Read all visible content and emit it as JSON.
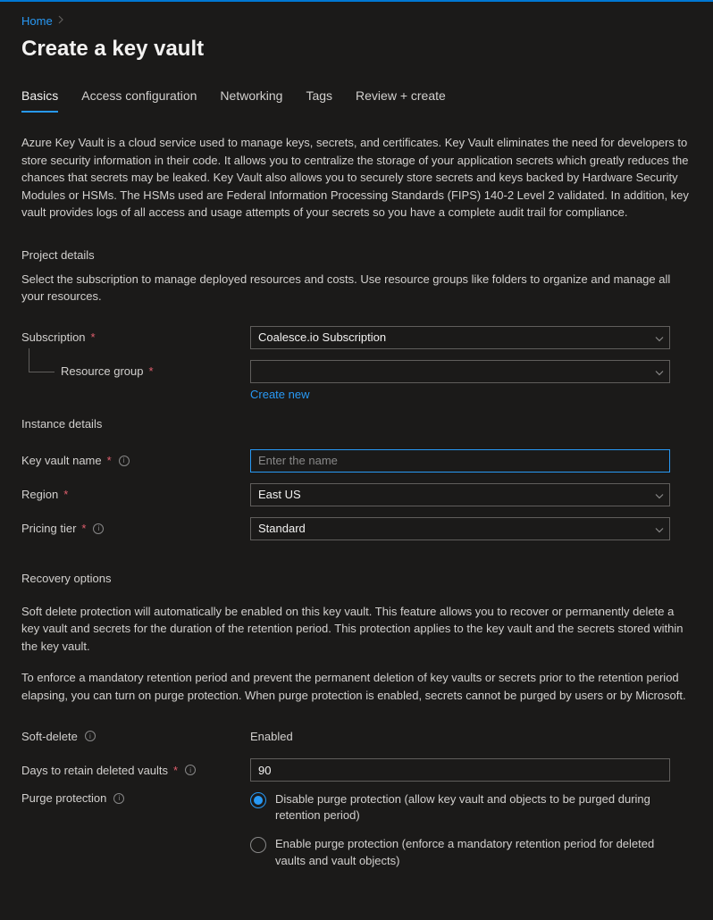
{
  "breadcrumb": {
    "home": "Home"
  },
  "page_title": "Create a key vault",
  "tabs": {
    "basics": "Basics",
    "access": "Access configuration",
    "networking": "Networking",
    "tags": "Tags",
    "review": "Review + create"
  },
  "description": "Azure Key Vault is a cloud service used to manage keys, secrets, and certificates. Key Vault eliminates the need for developers to store security information in their code. It allows you to centralize the storage of your application secrets which greatly reduces the chances that secrets may be leaked. Key Vault also allows you to securely store secrets and keys backed by Hardware Security Modules or HSMs. The HSMs used are Federal Information Processing Standards (FIPS) 140-2 Level 2 validated. In addition, key vault provides logs of all access and usage attempts of your secrets so you have a complete audit trail for compliance.",
  "project_details": {
    "title": "Project details",
    "desc": "Select the subscription to manage deployed resources and costs. Use resource groups like folders to organize and manage all your resources.",
    "subscription_label": "Subscription",
    "subscription_value": "Coalesce.io Subscription",
    "resource_group_label": "Resource group",
    "resource_group_value": "",
    "create_new": "Create new"
  },
  "instance_details": {
    "title": "Instance details",
    "name_label": "Key vault name",
    "name_placeholder": "Enter the name",
    "name_value": "",
    "region_label": "Region",
    "region_value": "East US",
    "tier_label": "Pricing tier",
    "tier_value": "Standard"
  },
  "recovery": {
    "title": "Recovery options",
    "desc1": "Soft delete protection will automatically be enabled on this key vault. This feature allows you to recover or permanently delete a key vault and secrets for the duration of the retention period. This protection applies to the key vault and the secrets stored within the key vault.",
    "desc2": "To enforce a mandatory retention period and prevent the permanent deletion of key vaults or secrets prior to the retention period elapsing, you can turn on purge protection. When purge protection is enabled, secrets cannot be purged by users or by Microsoft.",
    "soft_delete_label": "Soft-delete",
    "soft_delete_value": "Enabled",
    "days_label": "Days to retain deleted vaults",
    "days_value": "90",
    "purge_label": "Purge protection",
    "purge_opt1": "Disable purge protection (allow key vault and objects to be purged during retention period)",
    "purge_opt2": "Enable purge protection (enforce a mandatory retention period for deleted vaults and vault objects)"
  }
}
